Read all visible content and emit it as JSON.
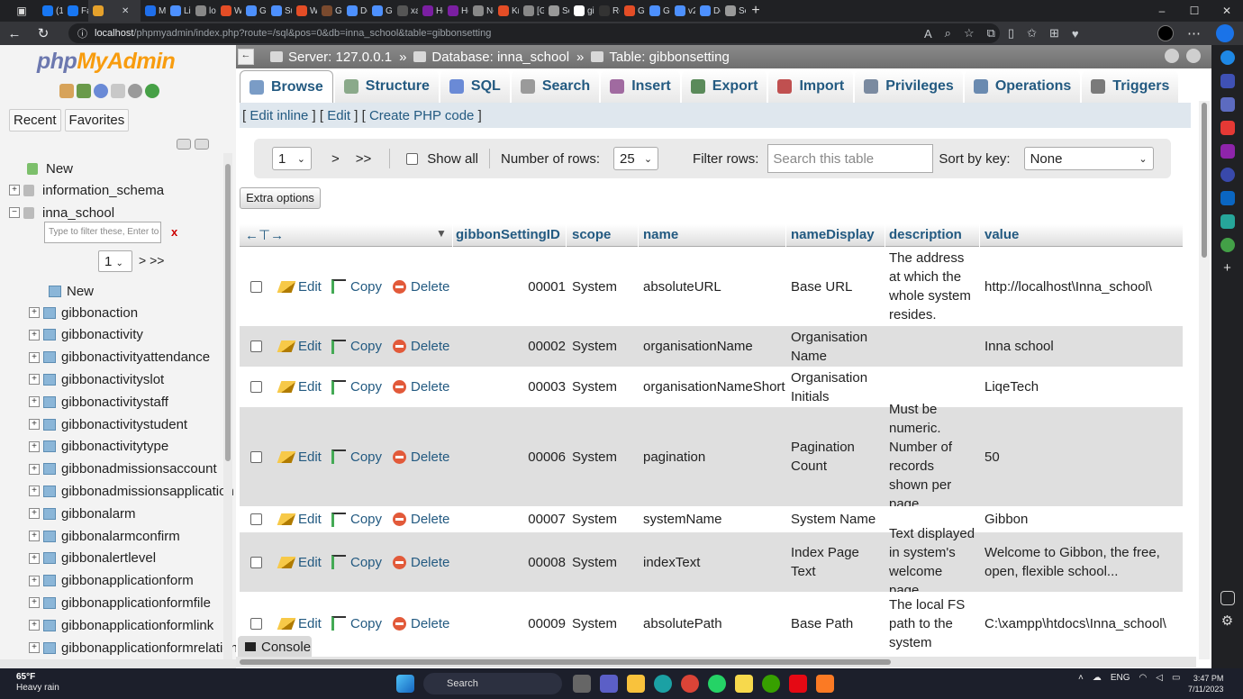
{
  "browser": {
    "tabs": [
      "(1) F",
      "Face",
      "",
      "MyS",
      "Liqe",
      "loca",
      "Wel",
      "Gibl",
      "Sup",
      "Wel",
      "Gibl",
      "Dov",
      "Gibl",
      "xam",
      "How",
      "How",
      "New",
      "Kren",
      "[Gil",
      "Sett",
      "gibl",
      "Rele",
      "Gibl",
      "Gibl",
      "v24.",
      "Dov",
      "Sett"
    ],
    "tab_colors": [
      "#1877f2",
      "#1877f2",
      "#e5a12b",
      "#1f6feb",
      "#4d90fe",
      "#888",
      "#e44d26",
      "#4d90fe",
      "#4d90fe",
      "#e44d26",
      "#7a4a2e",
      "#4d90fe",
      "#4d90fe",
      "#555",
      "#7b1fa2",
      "#7b1fa2",
      "#888",
      "#e44d26",
      "#888",
      "#999",
      "#fff",
      "#333",
      "#e44d26",
      "#4d90fe",
      "#4d90fe",
      "#4d90fe",
      "#999"
    ],
    "new_tab": "+",
    "url_host": "localhost",
    "url_path": "/phpmyadmin/index.php?route=/sql&pos=0&db=inna_school&table=gibbonsetting",
    "window_controls": [
      "–",
      "☐",
      "✕"
    ]
  },
  "sidebar": {
    "logo_php": "php",
    "logo_myadmin": "MyAdmin",
    "recent": "Recent",
    "favorites": "Favorites",
    "tree_new": "New",
    "databases": [
      "information_schema",
      "inna_school"
    ],
    "filter_placeholder": "Type to filter these, Enter to search",
    "filter_clear": "x",
    "page": "1",
    "page_nav": "> >>",
    "table_new": "New",
    "tables": [
      "gibbonaction",
      "gibbonactivity",
      "gibbonactivityattendance",
      "gibbonactivityslot",
      "gibbonactivitystaff",
      "gibbonactivitystudent",
      "gibbonactivitytype",
      "gibbonadmissionsaccount",
      "gibbonadmissionsapplication",
      "gibbonalarm",
      "gibbonalarmconfirm",
      "gibbonalertlevel",
      "gibbonapplicationform",
      "gibbonapplicationformfile",
      "gibbonapplicationformlink",
      "gibbonapplicationformrelationship"
    ]
  },
  "breadcrumb": {
    "server": "Server: 127.0.0.1",
    "database": "Database: inna_school",
    "table": "Table: gibbonsetting",
    "separator": "»"
  },
  "tabs": [
    "Browse",
    "Structure",
    "SQL",
    "Search",
    "Insert",
    "Export",
    "Import",
    "Privileges",
    "Operations",
    "Triggers"
  ],
  "edit_links": {
    "inline": "Edit inline",
    "edit": "Edit",
    "php": "Create PHP code"
  },
  "navbar": {
    "page": "1",
    "next": ">",
    "last": ">>",
    "show_all": "Show all",
    "rows_label": "Number of rows:",
    "rows_value": "25",
    "filter_label": "Filter rows:",
    "filter_placeholder": "Search this table",
    "sort_label": "Sort by key:",
    "sort_value": "None"
  },
  "extra_options": "Extra options",
  "columns": [
    "gibbonSettingID",
    "scope",
    "name",
    "nameDisplay",
    "description",
    "value"
  ],
  "row_actions": {
    "edit": "Edit",
    "copy": "Copy",
    "delete": "Delete"
  },
  "rows": [
    {
      "id": "00001",
      "scope": "System",
      "name": "absoluteURL",
      "nameDisplay": "Base URL",
      "description": "The address at which the whole system resides.",
      "value": "http://localhost\\Inna_school\\"
    },
    {
      "id": "00002",
      "scope": "System",
      "name": "organisationName",
      "nameDisplay": "Organisation Name",
      "description": "",
      "value": "Inna school"
    },
    {
      "id": "00003",
      "scope": "System",
      "name": "organisationNameShort",
      "nameDisplay": "Organisation Initials",
      "description": "",
      "value": "LiqeTech"
    },
    {
      "id": "00006",
      "scope": "System",
      "name": "pagination",
      "nameDisplay": "Pagination Count",
      "description": "Must be numeric. Number of records shown per page.",
      "value": "50"
    },
    {
      "id": "00007",
      "scope": "System",
      "name": "systemName",
      "nameDisplay": "System Name",
      "description": "",
      "value": "Gibbon"
    },
    {
      "id": "00008",
      "scope": "System",
      "name": "indexText",
      "nameDisplay": "Index Page Text",
      "description": "Text displayed in system's welcome page.",
      "value": "Welcome to Gibbon, the free, open, flexible school..."
    },
    {
      "id": "00009",
      "scope": "System",
      "name": "absolutePath",
      "nameDisplay": "Base Path",
      "description": "The local FS path to the system",
      "value": "C:\\xampp\\htdocs\\Inna_school\\"
    }
  ],
  "console": "Console",
  "taskbar": {
    "temp": "65°F",
    "weather": "Heavy rain",
    "search": "Search",
    "lang": "ENG",
    "time": "3:47 PM",
    "date": "7/11/2023"
  }
}
